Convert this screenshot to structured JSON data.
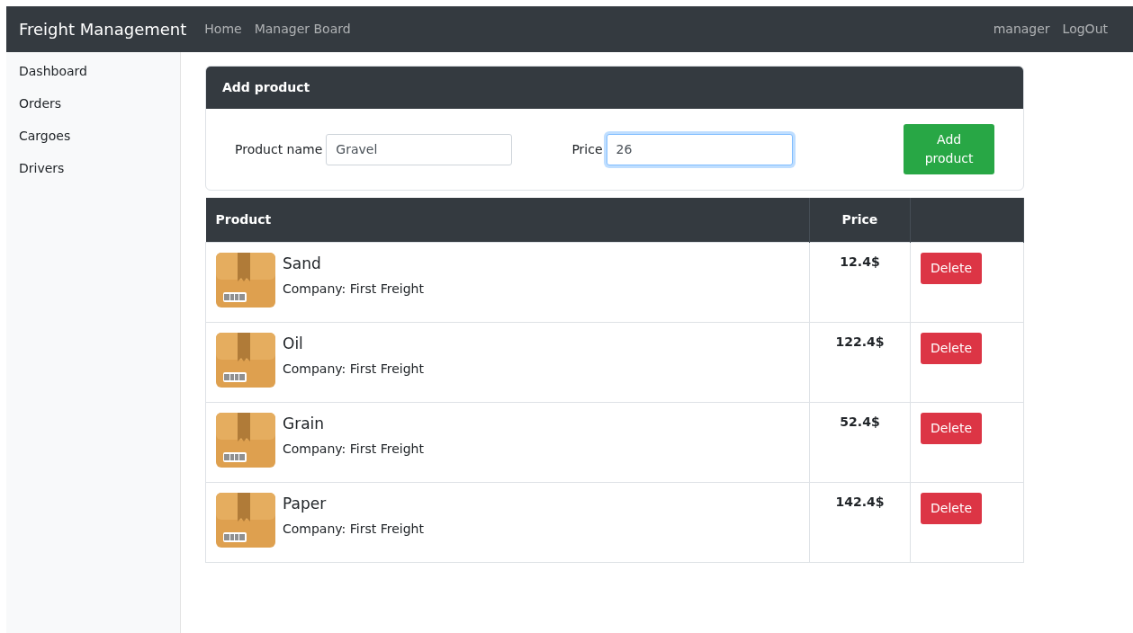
{
  "navbar": {
    "brand": "Freight Management",
    "links": [
      "Home",
      "Manager Board"
    ],
    "right_links": [
      "manager",
      "LogOut"
    ]
  },
  "sidebar": {
    "items": [
      "Dashboard",
      "Orders",
      "Cargoes",
      "Drivers"
    ]
  },
  "add_product": {
    "title": "Add product",
    "fields": [
      {
        "label": "Product name",
        "value": "Gravel",
        "kind": "text",
        "focused": false
      },
      {
        "label": "Price",
        "value": "26",
        "kind": "number",
        "focused": true
      }
    ],
    "button": "Add product"
  },
  "table": {
    "columns": [
      "Product",
      "Price"
    ],
    "rows": [
      {
        "name": "Sand",
        "company": "Company: First Freight",
        "price": "12.4$",
        "action": "Delete"
      },
      {
        "name": "Oil",
        "company": "Company: First Freight",
        "price": "122.4$",
        "action": "Delete"
      },
      {
        "name": "Grain",
        "company": "Company: First Freight",
        "price": "52.4$",
        "action": "Delete"
      },
      {
        "name": "Paper",
        "company": "Company: First Freight",
        "price": "142.4$",
        "action": "Delete"
      }
    ]
  }
}
